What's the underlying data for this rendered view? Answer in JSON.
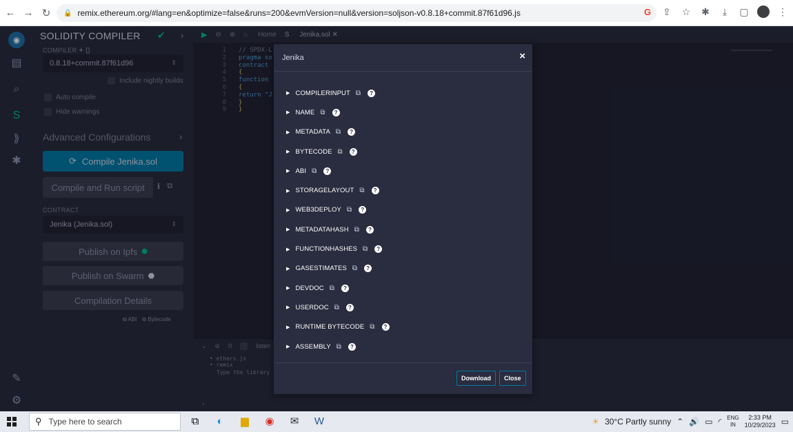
{
  "browser": {
    "url": "remix.ethereum.org/#lang=en&optimize=false&runs=200&evmVersion=null&version=soljson-v0.8.18+commit.87f61d96.js"
  },
  "sidebar": {
    "title": "SOLIDITY COMPILER",
    "compiler_label": "COMPILER",
    "compiler_version": "0.8.18+commit.87f61d96",
    "include_nightly": "Include nightly builds",
    "auto_compile": "Auto compile",
    "hide_warnings": "Hide warnings",
    "advanced": "Advanced Configurations",
    "compile_button": "Compile Jenika.sol",
    "compile_run_button": "Compile and Run script",
    "contract_label": "CONTRACT",
    "contract_value": "Jenika (Jenika.sol)",
    "publish_ipfs": "Publish on Ipfs",
    "publish_swarm": "Publish on Swarm",
    "compilation_details": "Compilation Details",
    "abi_link": "ABI",
    "bytecode_link": "Bytecode"
  },
  "editor": {
    "tab_home": "Home",
    "tab_file": "Jenika.sol",
    "lines": [
      {
        "n": "1",
        "text": "// SPDX-L",
        "color": "#7d7f97"
      },
      {
        "n": "2",
        "text": "pragma so",
        "color": "#4d9ccf"
      },
      {
        "n": "3",
        "text": "contract",
        "color": "#4d9ccf"
      },
      {
        "n": "4",
        "text": "{",
        "color": "#d3c65a"
      },
      {
        "n": "5",
        "text": "function",
        "color": "#4d9ccf"
      },
      {
        "n": "6",
        "text": "{",
        "color": "#d3c65a"
      },
      {
        "n": "7",
        "text": "return \"J",
        "color": "#4d9ccf"
      },
      {
        "n": "8",
        "text": "}",
        "color": "#d3c65a"
      },
      {
        "n": "9",
        "text": "}",
        "color": "#d3c65a"
      }
    ],
    "terminal_count": "0",
    "terminal_listen": "listen",
    "terminal_lines": [
      "• ethers.js",
      "• remix"
    ],
    "terminal_prompt": "Type the library"
  },
  "modal": {
    "title": "Jenika",
    "items": [
      "COMPILERINPUT",
      "NAME",
      "METADATA",
      "BYTECODE",
      "ABI",
      "STORAGELAYOUT",
      "WEB3DEPLOY",
      "METADATAHASH",
      "FUNCTIONHASHES",
      "GASESTIMATES",
      "DEVDOC",
      "USERDOC",
      "RUNTIME BYTECODE",
      "ASSEMBLY"
    ],
    "download_label": "Download",
    "close_label": "Close"
  },
  "taskbar": {
    "search_placeholder": "Type here to search",
    "weather": "30°C Partly sunny",
    "lang_top": "ENG",
    "lang_bottom": "IN",
    "time": "2:33 PM",
    "date": "10/29/2023"
  },
  "colors": {
    "accent": "#007aa6",
    "success": "#00bc8c",
    "panel_bg": "#2a2c3f"
  }
}
